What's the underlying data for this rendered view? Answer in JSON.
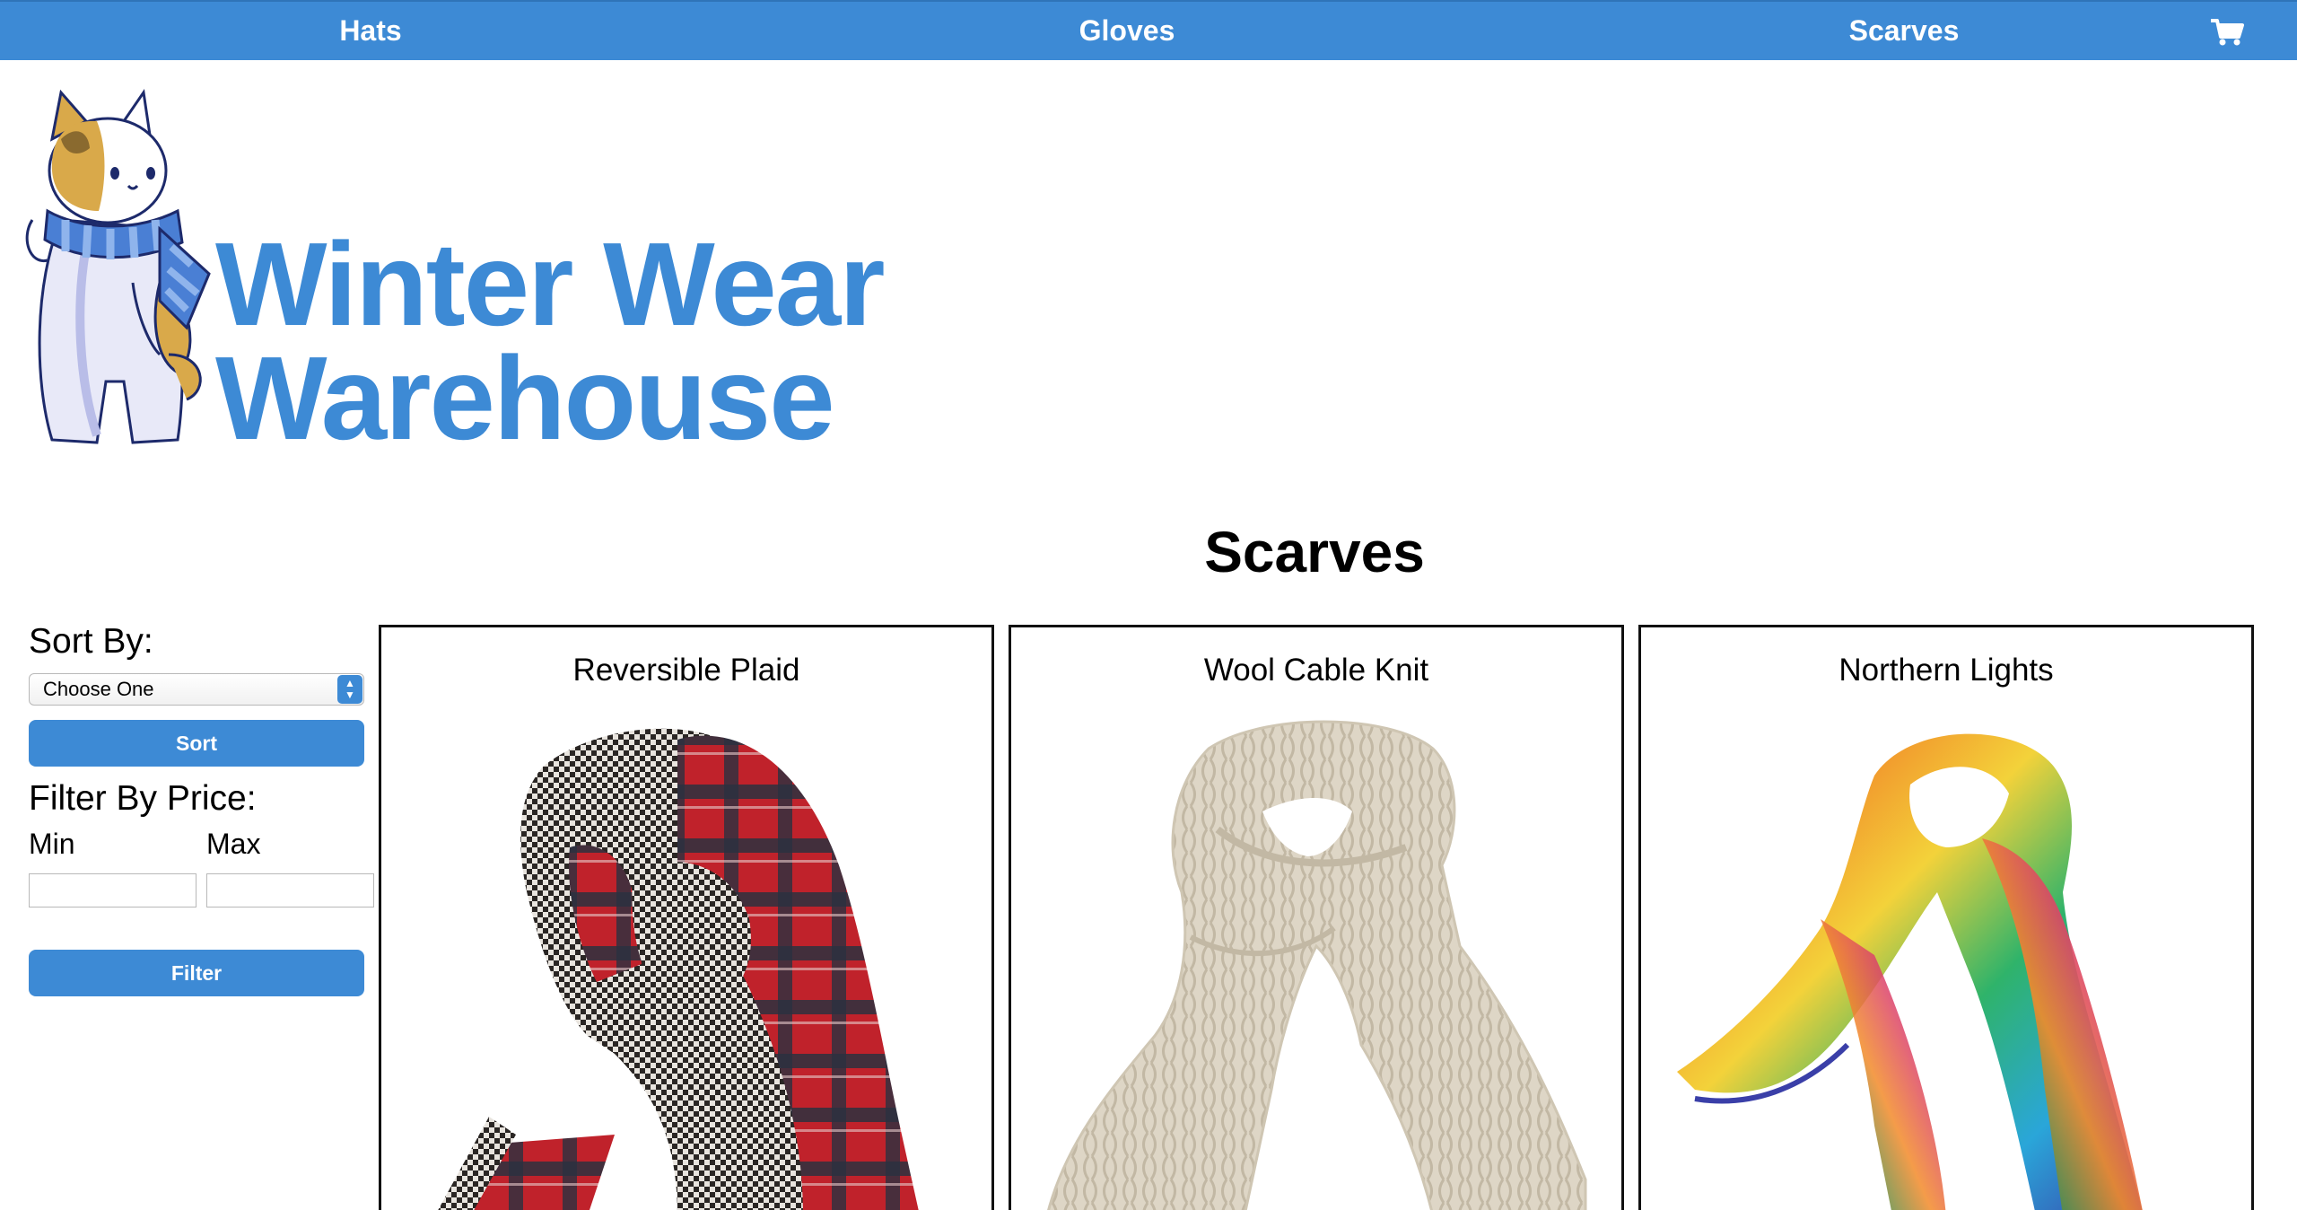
{
  "nav": {
    "items": [
      {
        "label": "Hats"
      },
      {
        "label": "Gloves"
      },
      {
        "label": "Scarves"
      }
    ],
    "cart_icon": "shopping-cart-icon",
    "background_color": "#3d8ad5"
  },
  "header": {
    "title_line1": "Winter Wear",
    "title_line2": "Warehouse",
    "title_color": "#3d8ad5",
    "mascot_icon": "cat-with-scarf-mascot"
  },
  "page": {
    "title": "Scarves"
  },
  "sidebar": {
    "sort_heading": "Sort By:",
    "sort_select_value": "Choose One",
    "sort_button_label": "Sort",
    "filter_heading": "Filter By Price:",
    "min_label": "Min",
    "max_label": "Max",
    "min_value": "",
    "max_value": "",
    "filter_button_label": "Filter"
  },
  "products": [
    {
      "name": "Reversible Plaid",
      "image": "plaid-scarf-image"
    },
    {
      "name": "Wool Cable Knit",
      "image": "cable-knit-scarf-image"
    },
    {
      "name": "Northern Lights",
      "image": "multicolor-scarf-image"
    }
  ],
  "colors": {
    "accent": "#3d8ad5",
    "card_border": "#111111"
  }
}
